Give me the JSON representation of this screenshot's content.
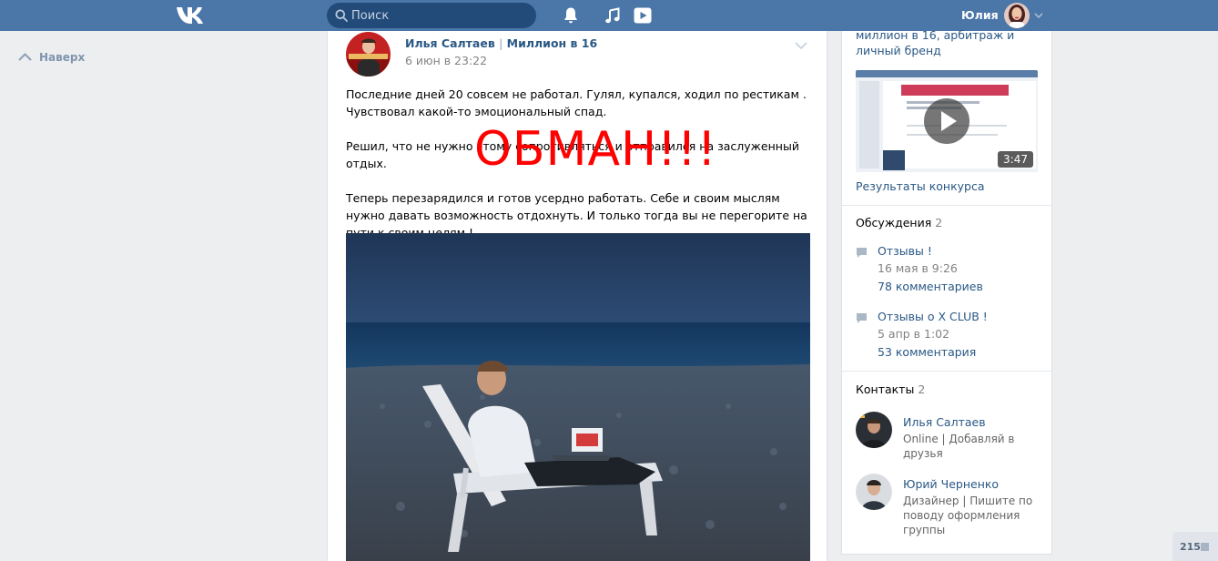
{
  "topbar": {
    "logo_icon": "vk-logo",
    "search": {
      "placeholder": "Поиск"
    },
    "icons": [
      "bell-icon",
      "music-icon",
      "video-play-icon"
    ],
    "user": {
      "name": "Юлия"
    }
  },
  "left": {
    "back_label": "Наверх"
  },
  "post": {
    "author": "Илья Салтаев",
    "separator": "|",
    "group": "Миллион в 16",
    "date": "6 июн в 23:22",
    "paragraphs": [
      "Последние дней 20 совсем не работал. Гулял, купался, ходил по рестикам . Чувствовал какой-то эмоциональный спад.",
      "Решил, что не нужно этому сопротивляться и отправился на заслуженный отдых.",
      "Теперь перезарядился и готов усердно работать. Себе и своим мыслям нужно давать возможность отдохнуть. И только тогда вы не перегорите на пути к своим целям !"
    ],
    "overlay_text": "ОБМАН!!!"
  },
  "sidebar": {
    "video": {
      "caption": "миллион в 16, арбитраж и личный бренд",
      "duration": "3:47",
      "title": "Результаты конкурса"
    },
    "discussions": {
      "title": "Обсуждения",
      "count": "2",
      "items": [
        {
          "title": "Отзывы !",
          "date": "16 мая в 9:26",
          "comments": "78 комментариев"
        },
        {
          "title": "Отзывы о X CLUB !",
          "date": "5 апр в 1:02",
          "comments": "53 комментария"
        }
      ]
    },
    "contacts": {
      "title": "Контакты",
      "count": "2",
      "items": [
        {
          "name": "Илья Салтаев",
          "desc": "Online | Добавляй в друзья"
        },
        {
          "name": "Юрий Черненко",
          "desc": "Дизайнер | Пишите по поводу оформления группы"
        }
      ]
    }
  },
  "counter": {
    "value": "215"
  },
  "colors": {
    "header": "#4a76a8",
    "link": "#2a5885",
    "background": "#edeef0",
    "overlay": "#ff0000"
  }
}
